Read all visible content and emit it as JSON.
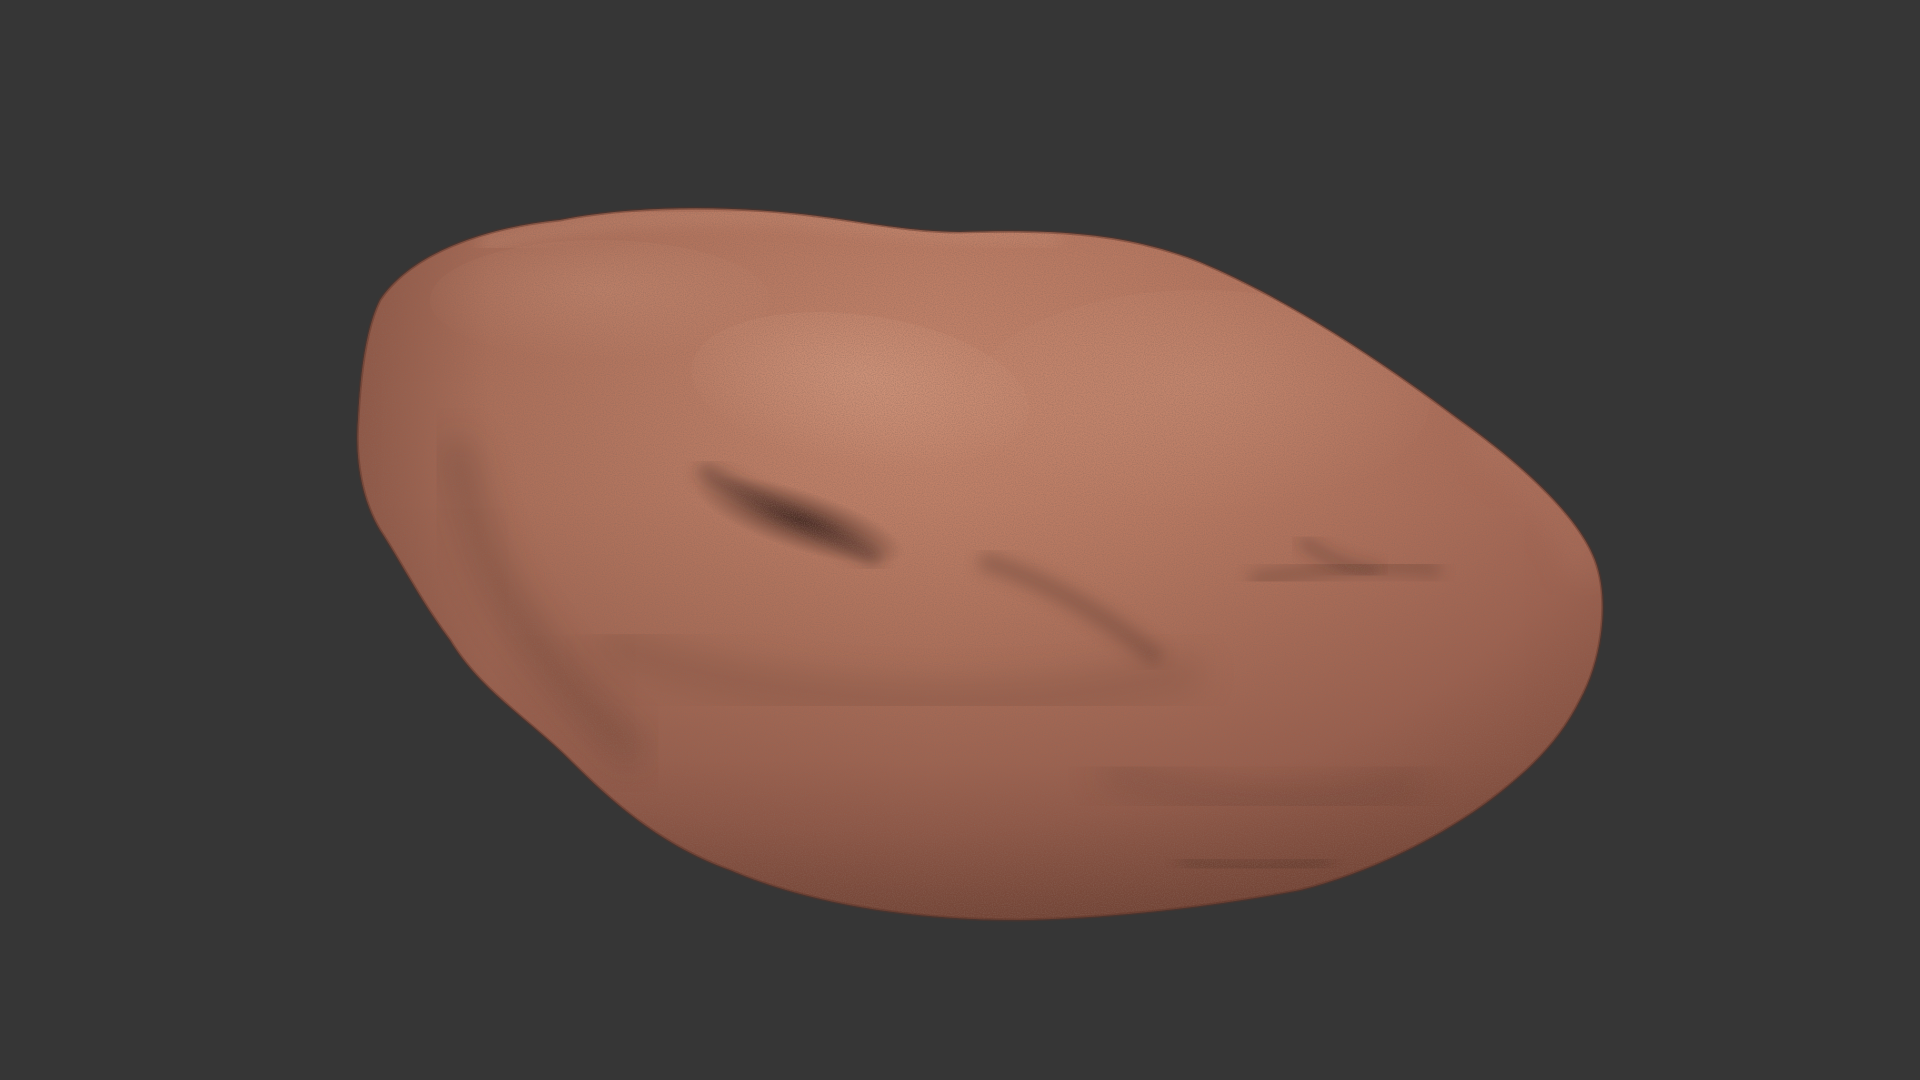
{
  "scene": {
    "background_color": "#363636",
    "subject": "rock",
    "rock_colors": {
      "base": "#b0705a",
      "highlight": "#c98b72",
      "shadow": "#6e4033",
      "deep_shadow": "#3d2620"
    }
  }
}
